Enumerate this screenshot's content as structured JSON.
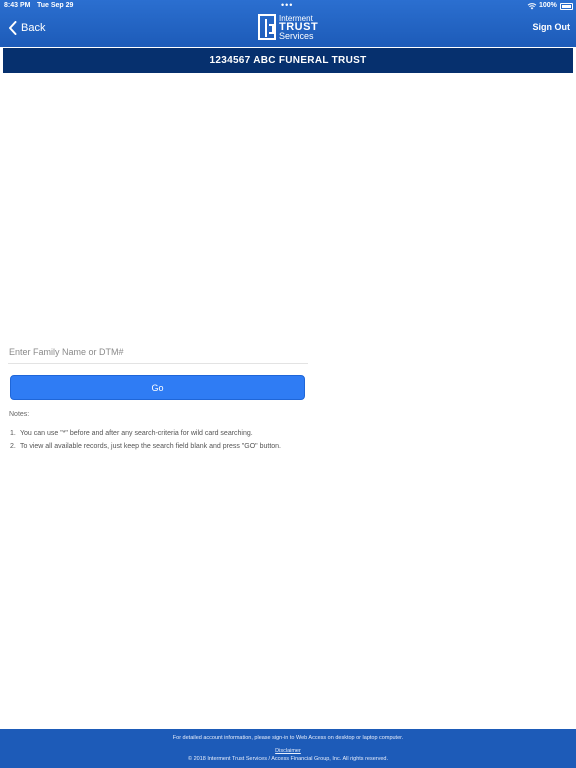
{
  "status_bar": {
    "time": "8:43 PM",
    "date": "Tue Sep 29",
    "battery": "100%",
    "dots": "•••",
    "icons": [
      "wifi-icon",
      "battery-icon"
    ]
  },
  "header": {
    "back_label": "Back",
    "logo": {
      "line1": "Interment",
      "line2": "TRUST",
      "line3": "Services"
    },
    "sign_out_label": "Sign Out",
    "background_color": "#1d5bb8"
  },
  "title_bar": {
    "title": "1234567 ABC FUNERAL TRUST",
    "background_color": "#06306e"
  },
  "search": {
    "placeholder": "Enter Family Name or DTM#",
    "value": "",
    "go_label": "Go",
    "button_color": "#2f7cf4"
  },
  "notes": {
    "title": "Notes:",
    "items": [
      {
        "num": "1.",
        "text": "You can use \"*\" before and after any search-criteria for wild card searching."
      },
      {
        "num": "2.",
        "text": "To view all available records, just keep the search field blank and press \"GO\" button."
      }
    ]
  },
  "footer": {
    "info": "For detailed account information, please sign-in to Web Access on desktop or laptop computer.",
    "link": "Disclaimer",
    "copyright": "© 2018 Interment Trust Services / Access Financial Group, Inc. All rights reserved."
  }
}
